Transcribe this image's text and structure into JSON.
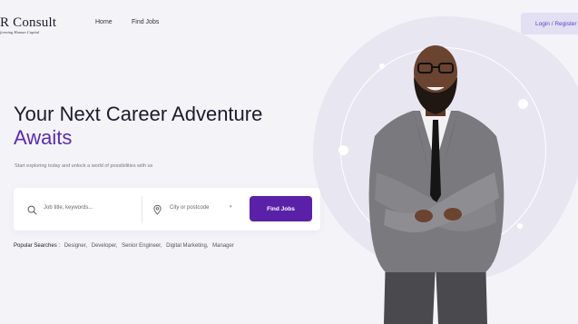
{
  "header": {
    "logo_main": "R Consult",
    "logo_sub": "forming Human Capital",
    "nav": [
      "Home",
      "Find Jobs"
    ],
    "login_label": "Login / Register"
  },
  "hero": {
    "title_line1": "Your Next Career Adventure",
    "title_line2": "Awaits",
    "subtitle": "Start exploring today and unlock a world of possibilities with us"
  },
  "search": {
    "keywords_placeholder": "Job title, keywords...",
    "location_placeholder": "City or postcode",
    "button_label": "Find Jobs"
  },
  "popular": {
    "label": "Popular Searches :",
    "terms": [
      "Designer,",
      "Developer,",
      "Senior Engineer,",
      "Digital Marketing,",
      "Manager"
    ]
  },
  "colors": {
    "accent": "#5a21a8",
    "title_purple": "#5b2bb4",
    "background": "#f4f3f8"
  },
  "icons": [
    "search-icon",
    "location-pin-icon",
    "chevron-down-icon"
  ]
}
